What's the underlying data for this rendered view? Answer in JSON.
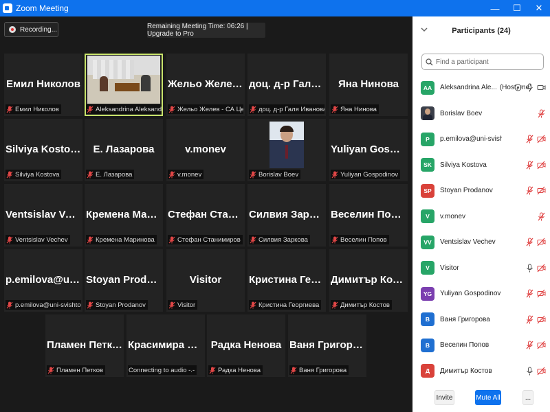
{
  "window": {
    "title": "Zoom Meeting"
  },
  "toolbar": {
    "recording_label": "Recording...",
    "timer_label": "Remaining Meeting Time: 06:26 | Upgrade to Pro"
  },
  "tiles": [
    {
      "name": "Емил Николов",
      "caption": "Емил Николов",
      "kind": "name"
    },
    {
      "name": "",
      "caption": "Aleksandrina Aleksandrova",
      "kind": "video"
    },
    {
      "name": "Жельо Желев -...",
      "caption": "Жельо Желев - СА Ценов",
      "kind": "name"
    },
    {
      "name": "доц. д-р Галя...",
      "caption": "доц. д-р Галя Иванова -...",
      "kind": "name"
    },
    {
      "name": "Яна Нинова",
      "caption": "Яна Нинова",
      "kind": "name"
    },
    {
      "name": "Silviya Kostova",
      "caption": "Silviya Kostova",
      "kind": "name"
    },
    {
      "name": "Е. Лазарова",
      "caption": "Е. Лазарова",
      "kind": "name"
    },
    {
      "name": "v.monev",
      "caption": "v.monev",
      "kind": "name"
    },
    {
      "name": "",
      "caption": "Borislav Boev",
      "kind": "photo"
    },
    {
      "name": "Yuliyan Gospod...",
      "caption": "Yuliyan Gospodinov",
      "kind": "name"
    },
    {
      "name": "Ventsislav Vechev",
      "caption": "Ventsislav Vechev",
      "kind": "name"
    },
    {
      "name": "Кремена Мари...",
      "caption": "Кремена Маринова",
      "kind": "name"
    },
    {
      "name": "Стефан Станим...",
      "caption": "Стефан Станимиров",
      "kind": "name"
    },
    {
      "name": "Силвия Заркова",
      "caption": "Силвия Заркова",
      "kind": "name"
    },
    {
      "name": "Веселин Попов",
      "caption": "Веселин Попов",
      "kind": "name"
    },
    {
      "name": "p.emilova@uni-...",
      "caption": "p.emilova@uni-svishtov.bg",
      "kind": "name"
    },
    {
      "name": "Stoyan Prodanov",
      "caption": "Stoyan Prodanov",
      "kind": "name"
    },
    {
      "name": "Visitor",
      "caption": "Visitor",
      "kind": "name"
    },
    {
      "name": "Кристина Георг...",
      "caption": "Кристина Георгиева",
      "kind": "name"
    },
    {
      "name": "Димитър Костов",
      "caption": "Димитър Костов",
      "kind": "name"
    },
    {
      "name": "Пламен Петков",
      "caption": "Пламен Петков",
      "kind": "name"
    },
    {
      "name": "Красимира Сла...",
      "caption": "Connecting to audio -.-",
      "kind": "name",
      "nomic": true
    },
    {
      "name": "Радка Ненова",
      "caption": "Радка Ненова",
      "kind": "name"
    },
    {
      "name": "Ваня Григорова",
      "caption": "Ваня Григорова",
      "kind": "name"
    }
  ],
  "panel": {
    "title": "Participants (24)",
    "search_placeholder": "Find a participant",
    "participants": [
      {
        "initials": "AA",
        "color": "#27a567",
        "name": "Aleksandrina Ale...",
        "tag": "(Host, me)",
        "mic": "on",
        "video": "on",
        "record": true
      },
      {
        "initials": "",
        "color": "",
        "name": "Borislav Boev",
        "mic": "muted"
      },
      {
        "initials": "P",
        "color": "#27a567",
        "name": "p.emilova@uni-svishtov.bg",
        "mic": "muted",
        "video": "off"
      },
      {
        "initials": "SK",
        "color": "#27a567",
        "name": "Silviya Kostova",
        "mic": "muted",
        "video": "off"
      },
      {
        "initials": "SP",
        "color": "#d9423a",
        "name": "Stoyan Prodanov",
        "mic": "muted",
        "video": "off"
      },
      {
        "initials": "V",
        "color": "#27a567",
        "name": "v.monev",
        "mic": "muted"
      },
      {
        "initials": "VV",
        "color": "#27a567",
        "name": "Ventsislav Vechev",
        "mic": "muted",
        "video": "off"
      },
      {
        "initials": "V",
        "color": "#27a567",
        "name": "Visitor",
        "mic": "on",
        "video": "off"
      },
      {
        "initials": "YG",
        "color": "#7b3fb0",
        "name": "Yuliyan Gospodinov",
        "mic": "muted",
        "video": "off"
      },
      {
        "initials": "В",
        "color": "#1f6fd1",
        "name": "Ваня Григорова",
        "mic": "muted",
        "video": "off"
      },
      {
        "initials": "В",
        "color": "#1f6fd1",
        "name": "Веселин Попов",
        "mic": "muted",
        "video": "off"
      },
      {
        "initials": "Д",
        "color": "#d9423a",
        "name": "Димитър Костов",
        "mic": "on",
        "video": "off"
      }
    ],
    "invite_label": "Invite",
    "mute_all_label": "Mute All",
    "more_label": "..."
  }
}
